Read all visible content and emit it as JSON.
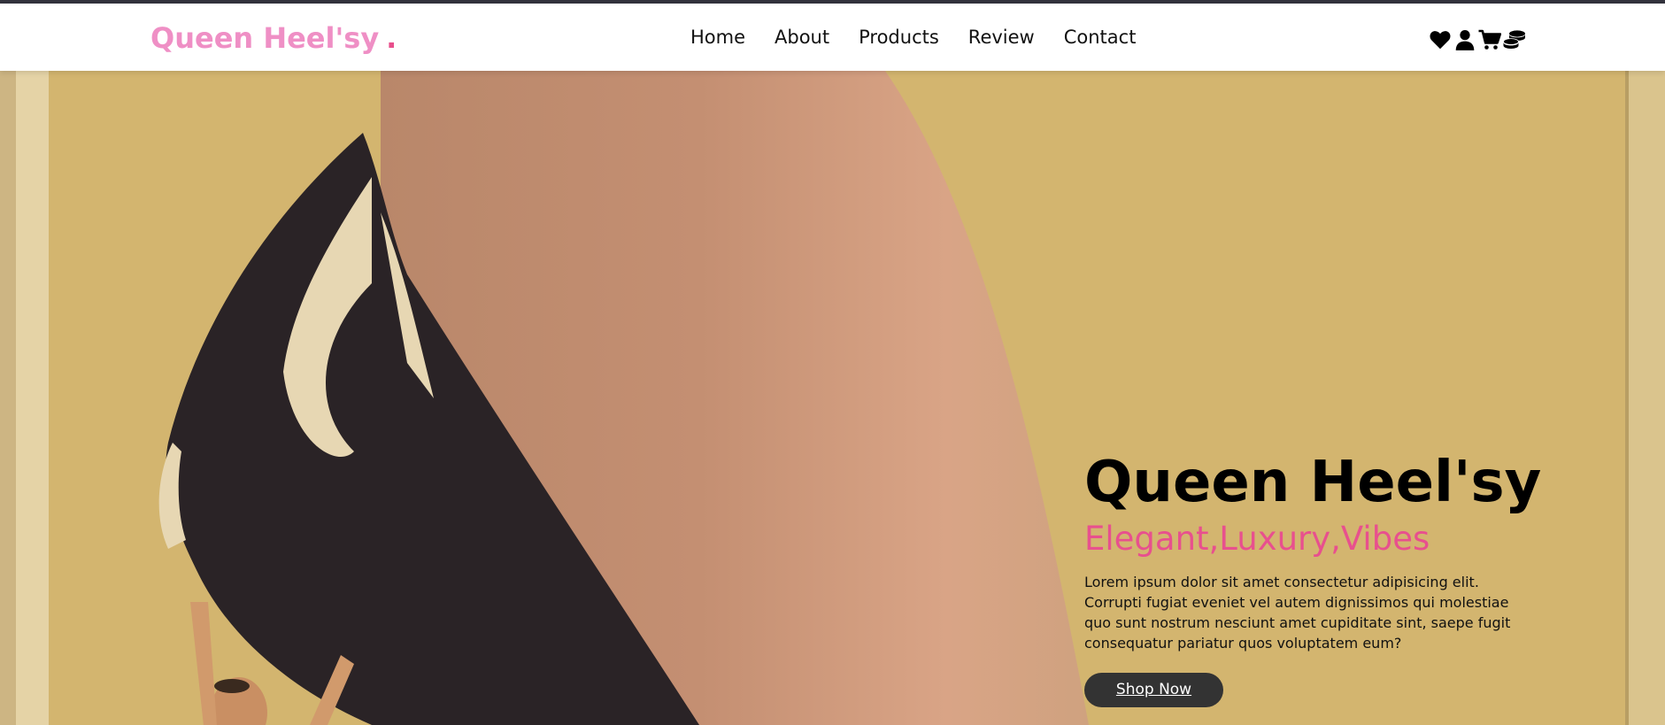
{
  "header": {
    "logo_text": "Queen Heel'sy",
    "logo_dot": ".",
    "nav": [
      {
        "label": "Home"
      },
      {
        "label": "About"
      },
      {
        "label": "Products"
      },
      {
        "label": "Review"
      },
      {
        "label": "Contact"
      }
    ],
    "icons": [
      "heart-icon",
      "user-icon",
      "cart-icon",
      "coins-icon"
    ]
  },
  "hero": {
    "title": "Queen Heel'sy",
    "subtitle": "Elegant,Luxury,Vibes",
    "description": "Lorem ipsum dolor sit amet consectetur adipisicing elit. Corrupti fugiat eveniet vel autem dignissimos qui molestiae quo sunt nostrum nesciunt amet cupiditate sint, saepe fugit consequatur pariatur quos voluptatem eum?",
    "cta_label": "Shop Now"
  },
  "colors": {
    "brand_pink": "#ef8fc5",
    "accent_pink": "#e8508e",
    "button_bg": "#333333",
    "hero_bg": "#d2b46f"
  }
}
